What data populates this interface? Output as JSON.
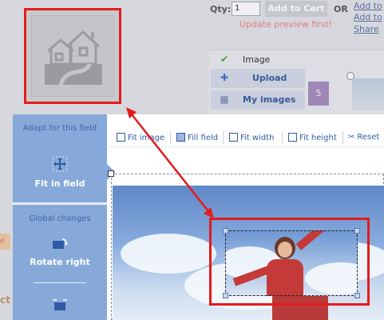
{
  "product": {
    "qty_label": "Qty:",
    "qty_value": "1",
    "add_to_cart_label": "Add to Cart",
    "or_label": "OR",
    "side_links": [
      "Add to",
      "Add to",
      "Share"
    ],
    "update_preview_message": "Update preview first!"
  },
  "image_options": {
    "image_label": "Image",
    "upload_label": "Upload",
    "my_images_label": "My images",
    "purple_box_text": "5"
  },
  "sidebar": {
    "adapt_heading": "Adapt for this field",
    "fit_in_field_label": "Fit in field",
    "global_heading": "Global changes",
    "rotate_right_label": "Rotate right"
  },
  "toolbar": {
    "fit_image_label": "Fit image",
    "fill_field_label": "Fill field",
    "fit_width_label": "Fit width",
    "fit_height_label": "Fit height",
    "reset_label": "Reset"
  },
  "left_fragments": {
    "orange_fragment": "e",
    "bold_fragment": "ct"
  },
  "colors": {
    "highlight_red": "#e31b1b",
    "sidebar_blue": "#86a9d9",
    "toolbar_link": "#2e5aa7",
    "update_pink": "#e07b8b"
  },
  "icons": {
    "fit_in_field": "move-arrows-icon",
    "rotate_right": "rotate-right-icon",
    "house": "house-placeholder-icon"
  }
}
